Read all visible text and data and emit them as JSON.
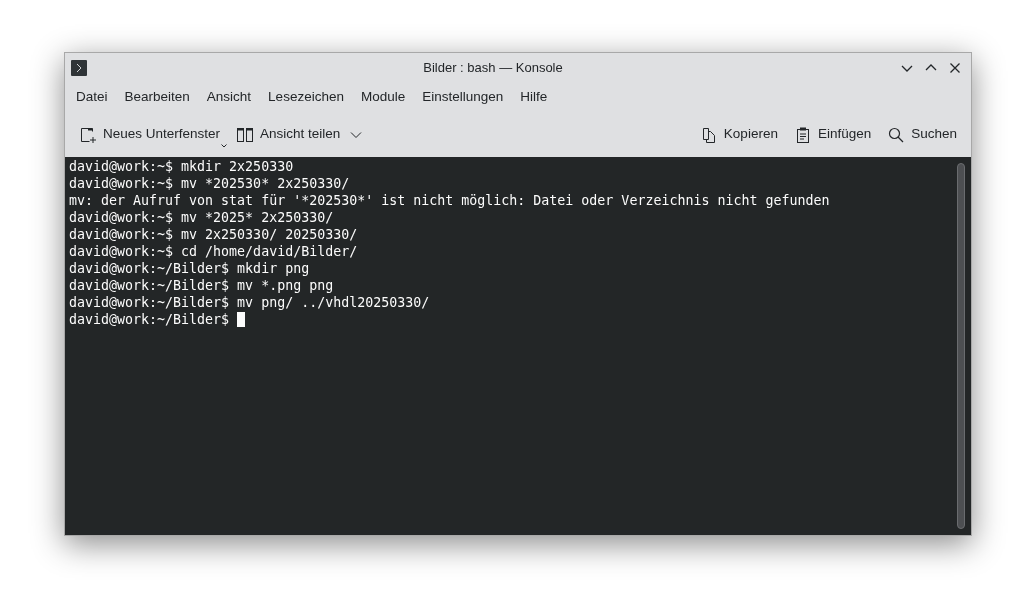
{
  "window": {
    "title": "Bilder : bash — Konsole"
  },
  "menu": [
    "Datei",
    "Bearbeiten",
    "Ansicht",
    "Lesezeichen",
    "Module",
    "Einstellungen",
    "Hilfe"
  ],
  "toolbar": {
    "left": [
      "Neues Unterfenster",
      "Ansicht teilen"
    ],
    "right": [
      "Kopieren",
      "Einfügen",
      "Suchen"
    ]
  },
  "terminal": {
    "lines": [
      "david@work:~$ mkdir 2x250330",
      "david@work:~$ mv *202530* 2x250330/",
      "mv: der Aufruf von stat für '*202530*' ist nicht möglich: Datei oder Verzeichnis nicht gefunden",
      "david@work:~$ mv *2025* 2x250330/",
      "david@work:~$ mv 2x250330/ 20250330/",
      "david@work:~$ cd /home/david/Bilder/",
      "david@work:~/Bilder$ mkdir png",
      "david@work:~/Bilder$ mv *.png png",
      "david@work:~/Bilder$ mv png/ ../vhdl20250330/"
    ],
    "prompt": "david@work:~/Bilder$",
    "cursor": true
  }
}
